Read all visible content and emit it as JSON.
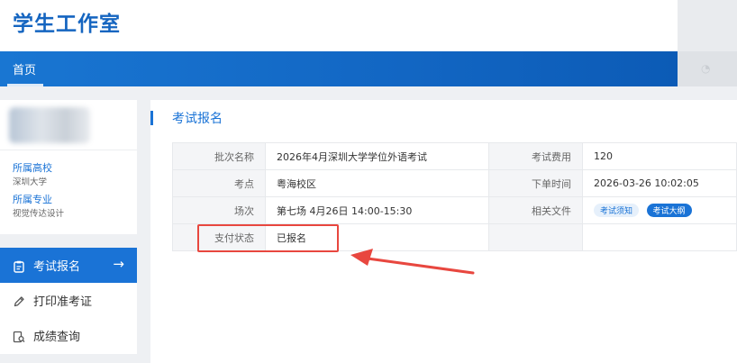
{
  "app": {
    "title": "学生工作室"
  },
  "nav": {
    "home_label": "首页"
  },
  "profile": {
    "school_label": "所属高校",
    "school_value": "深圳大学",
    "major_label": "所属专业",
    "major_value": "视觉传达设计"
  },
  "menu": {
    "items": [
      {
        "label": "考试报名",
        "icon": "clipboard-icon",
        "active": true
      },
      {
        "label": "打印准考证",
        "icon": "pencil-icon",
        "active": false
      },
      {
        "label": "成绩查询",
        "icon": "search-doc-icon",
        "active": false
      }
    ],
    "arrow": "→"
  },
  "main": {
    "title": "考试报名",
    "rows": [
      {
        "k1": "批次名称",
        "v1": "2026年4月深圳大学学位外语考试",
        "k2": "考试费用",
        "v2": "120"
      },
      {
        "k1": "考点",
        "v1": "粤海校区",
        "k2": "下单时间",
        "v2": "2026-03-26 10:02:05"
      },
      {
        "k1": "场次",
        "v1": "第七场 4月26日 14:00-15:30",
        "k2": "相关文件",
        "v2": ""
      },
      {
        "k1": "支付状态",
        "v1": "已报名",
        "k2": "",
        "v2": ""
      }
    ],
    "files": [
      {
        "label": "考试须知"
      },
      {
        "label": "考试大纲"
      }
    ]
  },
  "colors": {
    "brand_blue": "#1a73d6",
    "paid_green": "#2e9e3e",
    "annotation_red": "#e8473f"
  }
}
